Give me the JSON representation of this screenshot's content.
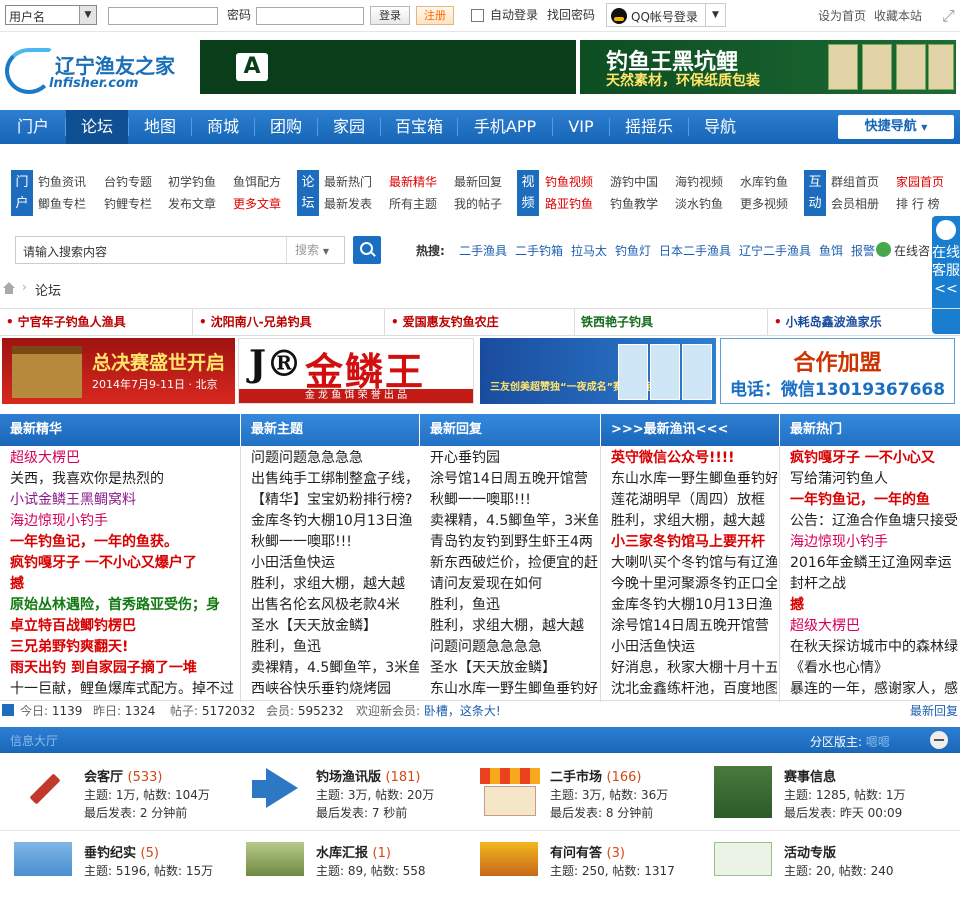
{
  "topbar": {
    "user_type": "用户名",
    "password_label": "密码",
    "login_btn": "登录",
    "register_btn": "注册",
    "auto_login": "自动登录",
    "find_password": "找回密码",
    "qq_login": "QQ帐号登录",
    "set_home": "设为首页",
    "bookmark": "收藏本站"
  },
  "header": {
    "logo_name": "辽宁渔友之家",
    "logo_domain": "lnfisher.com",
    "ad_a_letter": "A",
    "ad_fish_title": "钓鱼王黑坑鲤",
    "ad_fish_sub": "天然素材，环保纸质包装"
  },
  "nav": {
    "items": [
      "门户",
      "论坛",
      "地图",
      "商城",
      "团购",
      "家园",
      "百宝箱",
      "手机APP",
      "VIP",
      "摇摇乐",
      "导航"
    ],
    "quick": "快捷导航"
  },
  "subnav": {
    "groups": [
      {
        "tag": "门户",
        "links": [
          [
            "钓鱼资讯",
            "台钓专题",
            "初学钓鱼",
            "鱼饵配方"
          ],
          [
            "鲫鱼专栏",
            "钓鲤专栏",
            "发布文章",
            "更多文章"
          ]
        ]
      },
      {
        "tag": "论坛",
        "links": [
          [
            "最新热门",
            "最新精华",
            "最新回复"
          ],
          [
            "最新发表",
            "所有主题",
            "我的帖子"
          ]
        ]
      },
      {
        "tag": "视频",
        "links": [
          [
            "钓鱼视频",
            "游钓中国",
            "海钓视频",
            "水库钓鱼"
          ],
          [
            "路亚钓鱼",
            "钓鱼教学",
            "淡水钓鱼",
            "更多视频"
          ]
        ]
      },
      {
        "tag": "互动",
        "links": [
          [
            "群组首页",
            "家园首页"
          ],
          [
            "会员相册",
            "排 行 榜"
          ]
        ]
      }
    ]
  },
  "search": {
    "placeholder": "请输入搜索内容",
    "category": "搜索",
    "hot_label": "热搜:",
    "hot": [
      "二手渔具",
      "二手钓箱",
      "拉马太",
      "钓鱼灯",
      "日本二手渔具",
      "辽宁二手渔具",
      "鱼饵",
      "报警"
    ],
    "online": "在线咨"
  },
  "cs_tab": "在线客服<<",
  "breadcrumb": "论坛",
  "sponsors": [
    "宁官年子钓鱼人渔具",
    "沈阳南八-兄弟钓具",
    "爱国惠友钓鱼农庄",
    "铁西艳子钓具",
    "小耗岛鑫波渔家乐"
  ],
  "banners": {
    "b1_title": "总决赛盛世开启",
    "b1_date": "2014年7月9-11日 · 北京",
    "b2_logo": "J®",
    "b2_title": "金鳞王",
    "b2_foot": "金 龙 鱼 饵 荣 誉 出 品",
    "b3_text": "三友创美超赞独“一夜成名”赛事指定钓饵",
    "b4_title": "合作加盟",
    "b4_phone": "电话：微信13019367668"
  },
  "columns": {
    "headers": [
      "最新精华",
      "最新主题",
      "最新回复",
      ">>>最新渔讯<<<",
      "最新热门"
    ],
    "c1": [
      {
        "t": "超级大楞巴",
        "s": "pink"
      },
      {
        "t": "关西，我喜欢你是热烈的",
        "s": ""
      },
      {
        "t": "小试金鳞王黑鲷窝料",
        "s": "purple"
      },
      {
        "t": "海边惊现小钓手",
        "s": "pink"
      },
      {
        "t": "一年钓鱼记，一年的鱼获。",
        "s": "red"
      },
      {
        "t": "疯钓嘎牙子 一不小心又爆户了",
        "s": "red"
      },
      {
        "t": "撼",
        "s": "red"
      },
      {
        "t": "原始丛林遇险，首秀路亚受伤；身",
        "s": "green"
      },
      {
        "t": "卓立特百战鲫钓楞巴",
        "s": "red"
      },
      {
        "t": "三兄弟野钓爽翻天!",
        "s": "red"
      },
      {
        "t": "雨天出钓 到自家园子摘了一堆",
        "s": "red"
      },
      {
        "t": "十一巨献，鲤鱼爆库式配方。掉不过",
        "s": ""
      }
    ],
    "c2": [
      "问题问题急急急急",
      "出售纯手工绑制整盒子线，",
      "【精华】宝宝奶粉排行榜?",
      "金库冬钓大棚10月13日渔",
      "秋鲫一一噢耶!!!",
      "小田活鱼快运",
      "胜利，求组大棚，越大越",
      "出售名伦玄风极老款4米",
      "圣水【天天放金鳞】",
      "胜利，鱼迅",
      "卖裸精，4.5鲫鱼竿，3米鱼",
      "西峡谷快乐垂钓烧烤园"
    ],
    "c3": [
      "开心垂钓园",
      "涂号馆14日周五晚开馆营",
      "秋鲫一一噢耶!!!",
      "卖裸精，4.5鲫鱼竿，3米鱼",
      "青岛钓友钓到野生虾王4两",
      "新东西破烂价，捡便宜的赶",
      "请问友爱现在如何",
      "胜利，鱼迅",
      "胜利，求组大棚，越大越",
      "问题问题急急急急",
      "圣水【天天放金鳞】",
      "东山水库一野生鲫鱼垂钓好"
    ],
    "c4": [
      {
        "t": "英守微信公众号!!!!",
        "s": "red"
      },
      {
        "t": "东山水库一野生鲫鱼垂钓好",
        "s": ""
      },
      {
        "t": "莲花湖明早（周四）放框",
        "s": ""
      },
      {
        "t": "胜利，求组大棚，越大越",
        "s": ""
      },
      {
        "t": "小三家冬钓馆马上要开杆",
        "s": "red"
      },
      {
        "t": "大喇叭买个冬钓馆与有辽渔",
        "s": ""
      },
      {
        "t": "今晚十里河聚源冬钓正口全",
        "s": ""
      },
      {
        "t": "金库冬钓大棚10月13日渔",
        "s": ""
      },
      {
        "t": "涂号馆14日周五晚开馆营",
        "s": ""
      },
      {
        "t": "小田活鱼快运",
        "s": ""
      },
      {
        "t": "好消息，秋家大棚十月十五",
        "s": ""
      },
      {
        "t": "沈北金鑫练杆池，百度地图",
        "s": ""
      }
    ],
    "c5": [
      {
        "t": "疯钓嘎牙子 一不小心又",
        "s": "red"
      },
      {
        "t": "写给蒲河钓鱼人",
        "s": ""
      },
      {
        "t": "一年钓鱼记，一年的鱼",
        "s": "red"
      },
      {
        "t": "公告：辽渔合作鱼塘只接受",
        "s": ""
      },
      {
        "t": "海边惊现小钓手",
        "s": "pink"
      },
      {
        "t": "2016年金鳞王辽渔网幸运",
        "s": ""
      },
      {
        "t": "封杆之战",
        "s": ""
      },
      {
        "t": "撼",
        "s": "red"
      },
      {
        "t": "超级大楞巴",
        "s": "pink"
      },
      {
        "t": "在秋天探访城市中的森林绿",
        "s": ""
      },
      {
        "t": "《看水也心情》",
        "s": ""
      },
      {
        "t": "暴连的一年，感谢家人，感",
        "s": ""
      }
    ]
  },
  "stats": {
    "today_lbl": "今日:",
    "today": "1139",
    "yest_lbl": "昨日:",
    "yest": "1324",
    "posts_lbl": "帖子:",
    "posts": "5172032",
    "members_lbl": "会员:",
    "members": "595232",
    "welcome": "欢迎新会员:",
    "new_member": "卧槽，这条大!",
    "latest_reply": "最新回复"
  },
  "hall": {
    "title": "信息大厅",
    "moderator_lbl": "分区版主:",
    "moderator": "嗯嗯"
  },
  "forums": [
    {
      "name": "会客厅",
      "count": "(533)",
      "l1": "主题: 1万, 帖数: 104万",
      "l2": "最后发表: 2 分钟前"
    },
    {
      "name": "钓场渔讯版",
      "count": "(181)",
      "l1": "主题: 3万, 帖数: 20万",
      "l2": "最后发表: 7 秒前"
    },
    {
      "name": "二手市场",
      "count": "(166)",
      "l1": "主题: 3万, 帖数: 36万",
      "l2": "最后发表: 8 分钟前"
    },
    {
      "name": "赛事信息",
      "count": "",
      "l1": "主题: 1285, 帖数: 1万",
      "l2": "最后发表: 昨天 00:09"
    },
    {
      "name": "垂钓纪实",
      "count": "(5)",
      "l1": "主题: 5196, 帖数: 15万",
      "l2": ""
    },
    {
      "name": "水库汇报",
      "count": "(1)",
      "l1": "主题: 89, 帖数: 558",
      "l2": ""
    },
    {
      "name": "有问有答",
      "count": "(3)",
      "l1": "主题: 250, 帖数: 1317",
      "l2": ""
    },
    {
      "name": "活动专版",
      "count": "",
      "l1": "主题: 20, 帖数: 240",
      "l2": ""
    }
  ],
  "colors": {
    "brand_blue": "#1a67b9",
    "red": "#d80000"
  }
}
